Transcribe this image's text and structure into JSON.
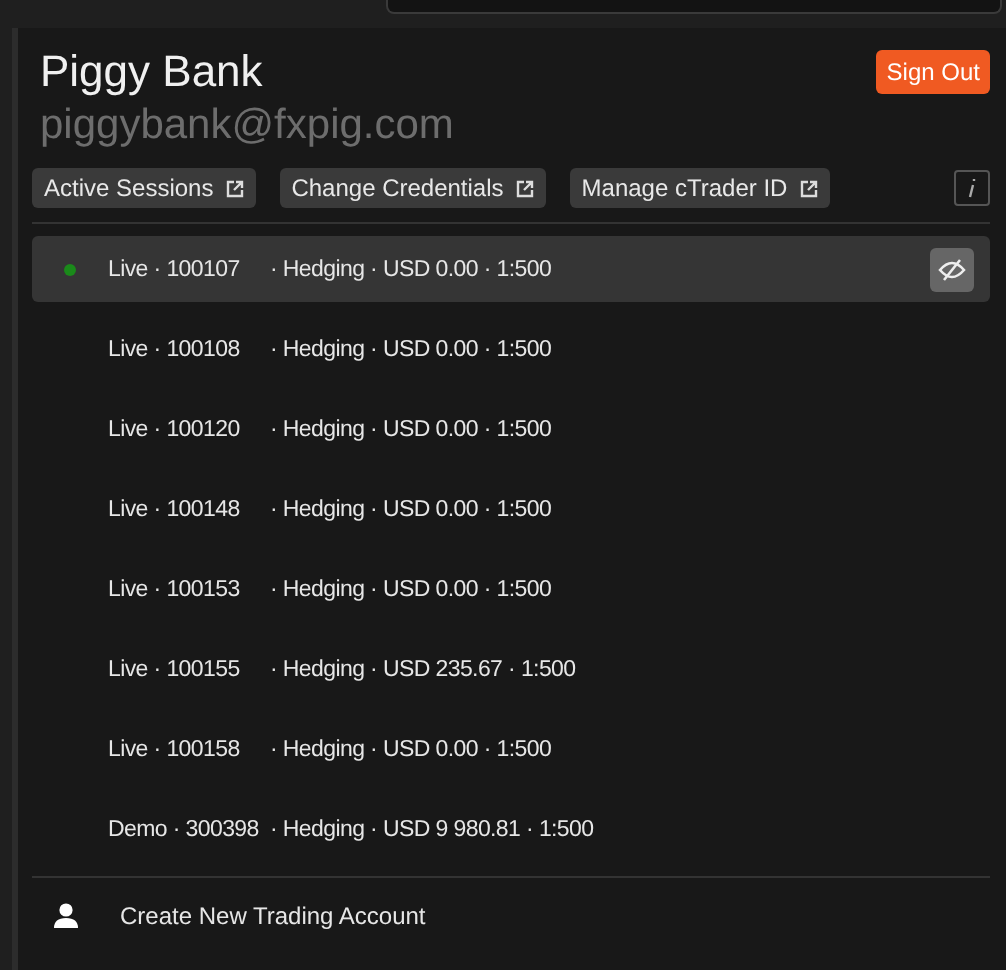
{
  "profile": {
    "name": "Piggy Bank",
    "email": "piggybank@fxpig.com",
    "sign_out": "Sign Out"
  },
  "links": [
    {
      "label": "Active Sessions"
    },
    {
      "label": "Change Credentials"
    },
    {
      "label": "Manage cTrader ID"
    }
  ],
  "accounts": [
    {
      "account": "Live · 100107",
      "details": "· Hedging · USD 0.00 · 1:500",
      "selected": true
    },
    {
      "account": "Live · 100108",
      "details": "· Hedging · USD 0.00 · 1:500",
      "selected": false
    },
    {
      "account": "Live · 100120",
      "details": "· Hedging · USD 0.00 · 1:500",
      "selected": false
    },
    {
      "account": "Live · 100148",
      "details": "· Hedging · USD 0.00 · 1:500",
      "selected": false
    },
    {
      "account": "Live · 100153",
      "details": "· Hedging · USD 0.00 · 1:500",
      "selected": false
    },
    {
      "account": "Live · 100155",
      "details": "· Hedging · USD 235.67 · 1:500",
      "selected": false
    },
    {
      "account": "Live · 100158",
      "details": "· Hedging · USD 0.00 · 1:500",
      "selected": false
    },
    {
      "account": "Demo · 300398",
      "details": "· Hedging · USD 9 980.81 · 1:500",
      "selected": false
    }
  ],
  "create_account": "Create New Trading Account"
}
